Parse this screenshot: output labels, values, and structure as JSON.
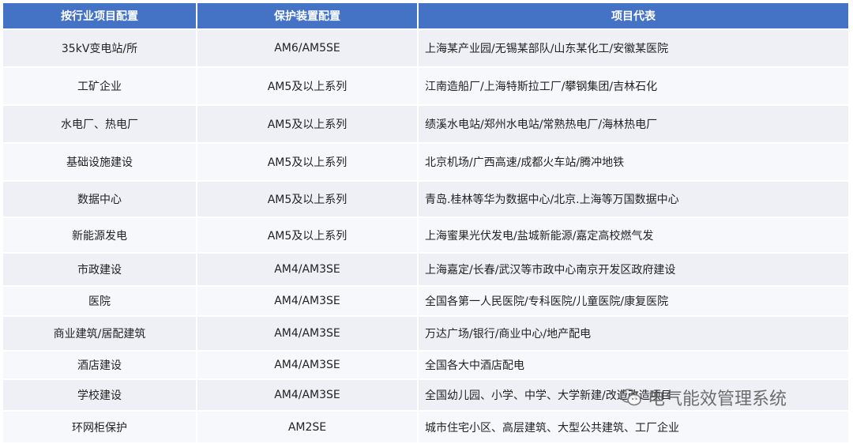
{
  "table": {
    "headers": [
      "按行业项目配置",
      "保护装置配置",
      "项目代表"
    ],
    "rows": [
      [
        "35kV变电站/所",
        "AM6/AM5SE",
        "上海某产业园/无锡某部队/山东某化工/安徽某医院"
      ],
      [
        "工矿企业",
        "AM5及以上系列",
        "江南造船厂/上海特斯拉工厂/攀钢集团/吉林石化"
      ],
      [
        "水电厂、热电厂",
        "AM5及以上系列",
        "绩溪水电站/郑州水电站/常熟热电厂/海林热电厂"
      ],
      [
        "基础设施建设",
        "AM5及以上系列",
        "北京机场/广西高速/成都火车站/腾冲地铁"
      ],
      [
        "数据中心",
        "AM5及以上系列",
        "青岛.桂林等华为数据中心/北京.上海等万国数据中心"
      ],
      [
        "新能源发电",
        "AM5及以上系列",
        "上海蜜果光伏发电/盐城新能源/嘉定高校燃气发"
      ],
      [
        "市政建设",
        "AM4/AM3SE",
        "上海嘉定/长春/武汉等市政中心南京开发区政府建设"
      ],
      [
        "医院",
        "AM4/AM3SE",
        "全国各第一人民医院/专科医院/儿童医院/康复医院"
      ],
      [
        "商业建筑/居配建筑",
        "AM4/AM3SE",
        "万达广场/银行/商业中心/地产配电"
      ],
      [
        "酒店建设",
        "AM4/AM3SE",
        "全国各大中酒店配电"
      ],
      [
        "学校建设",
        "AM4/AM3SE",
        "全国幼儿园、小学、中学、大学新建/改造改造项目"
      ],
      [
        "环网柜保护",
        "AM2SE",
        "城市住宅小区、高层建筑、大型公共建筑、工厂企业"
      ]
    ]
  },
  "watermark": {
    "text": "电气能效管理系统",
    "icon": "wechat-icon"
  },
  "colors": {
    "header_bg": "#4472c4",
    "row_bg_a": "#eef0f6",
    "row_bg_b": "#f7f8fb"
  }
}
